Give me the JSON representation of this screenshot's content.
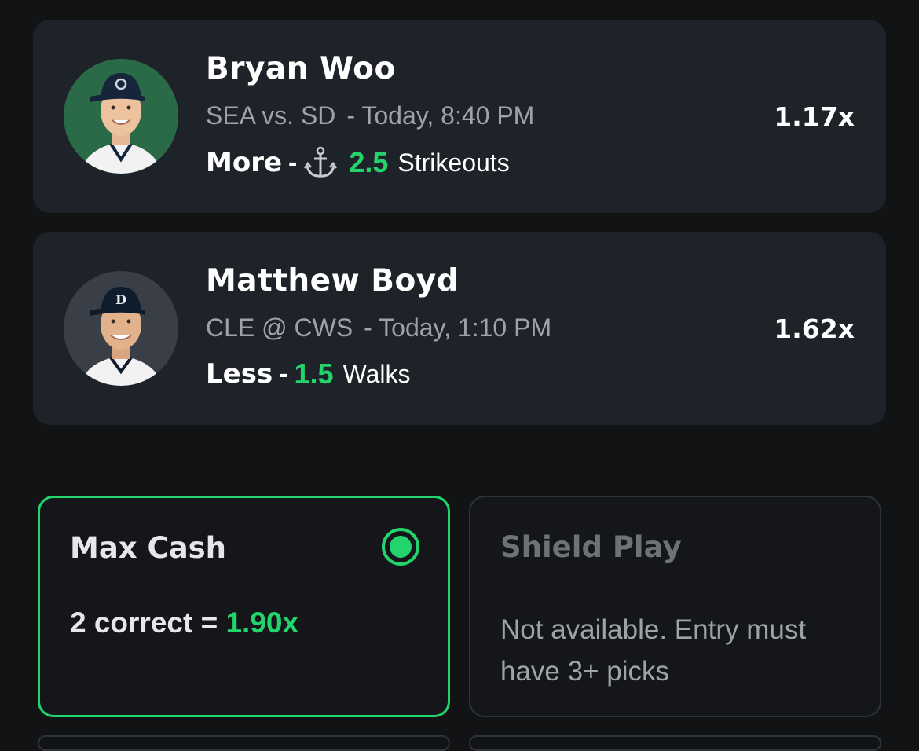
{
  "picks": [
    {
      "name": "Bryan Woo",
      "matchup": "SEA vs. SD",
      "time": "- Today, 8:40 PM",
      "direction": "More",
      "dash": "-",
      "anchor_icon": "anchor-icon",
      "line": "2.5",
      "stat": "Strikeouts",
      "multiplier": "1.17x",
      "avatar_bg": "#2b6a47",
      "cap_color": "#17253a"
    },
    {
      "name": "Matthew Boyd",
      "matchup": "CLE @ CWS",
      "time": "- Today, 1:10 PM",
      "direction": "Less",
      "dash": "-",
      "line": "1.5",
      "stat": "Walks",
      "multiplier": "1.62x",
      "avatar_bg": "#3a3f47",
      "cap_color": "#0f1c2e"
    }
  ],
  "options": {
    "max_cash": {
      "title": "Max Cash",
      "payout_prefix": "2 correct =",
      "payout_value": "1.90x",
      "selected": true
    },
    "shield_play": {
      "title": "Shield Play",
      "note": "Not available. Entry must have 3+ picks"
    }
  },
  "colors": {
    "accent": "#22d46b",
    "card_bg": "#1e232a",
    "page_bg": "#121315",
    "muted_text": "#9ea3aa"
  }
}
